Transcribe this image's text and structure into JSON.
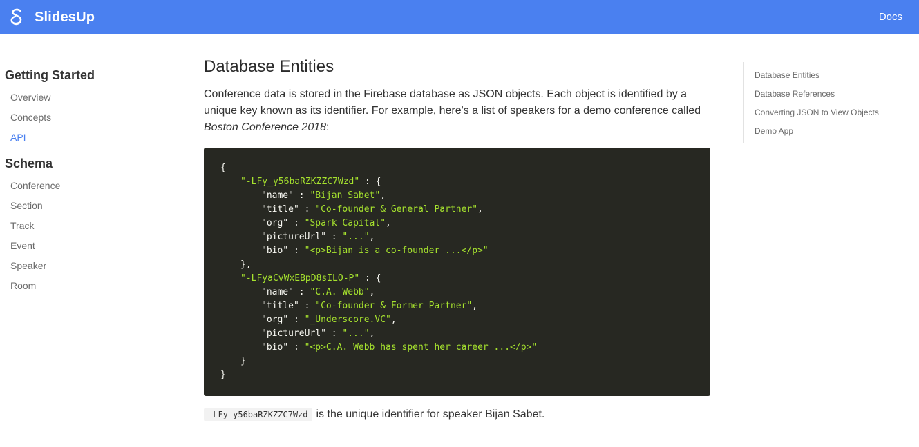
{
  "header": {
    "brand": "SlidesUp",
    "docs_label": "Docs",
    "logo_icon": "slidesup-logo-icon",
    "background": "#4a80f0"
  },
  "sidebar": {
    "sections": [
      {
        "heading": "Getting Started",
        "items": [
          {
            "label": "Overview",
            "active": false
          },
          {
            "label": "Concepts",
            "active": false
          },
          {
            "label": "API",
            "active": true
          }
        ]
      },
      {
        "heading": "Schema",
        "items": [
          {
            "label": "Conference",
            "active": false
          },
          {
            "label": "Section",
            "active": false
          },
          {
            "label": "Track",
            "active": false
          },
          {
            "label": "Event",
            "active": false
          },
          {
            "label": "Speaker",
            "active": false
          },
          {
            "label": "Room",
            "active": false
          }
        ]
      }
    ]
  },
  "main": {
    "title": "Database Entities",
    "intro_text": "Conference data is stored in the Firebase database as JSON objects. Each object is identified by a unique key known as its identifier. For example, here's a list of speakers for a demo conference called ",
    "intro_em": "Boston Conference 2018",
    "intro_end": ":",
    "code": {
      "open": "{",
      "close": "}",
      "entries": [
        {
          "key": "\"-LFy_y56baRZKZZC7Wzd\"",
          "fields": [
            {
              "name": "\"name\"",
              "value": "\"Bijan Sabet\"",
              "comma": ","
            },
            {
              "name": "\"title\"",
              "value": "\"Co-founder & General Partner\"",
              "comma": ","
            },
            {
              "name": "\"org\"",
              "value": "\"Spark Capital\"",
              "comma": ","
            },
            {
              "name": "\"pictureUrl\"",
              "value": "\"...\"",
              "comma": ","
            },
            {
              "name": "\"bio\"",
              "value": "\"<p>Bijan is a co-founder ...</p>\"",
              "comma": ""
            }
          ],
          "end": "},"
        },
        {
          "key": "\"-LFyaCvWxEBpD8sILO-P\"",
          "fields": [
            {
              "name": "\"name\"",
              "value": "\"C.A. Webb\"",
              "comma": ","
            },
            {
              "name": "\"title\"",
              "value": "\"Co-founder & Former Partner\"",
              "comma": ","
            },
            {
              "name": "\"org\"",
              "value": "\"_Underscore.VC\"",
              "comma": ","
            },
            {
              "name": "\"pictureUrl\"",
              "value": "\"...\"",
              "comma": ","
            },
            {
              "name": "\"bio\"",
              "value": "\"<p>C.A. Webb has spent her career ...</p>\"",
              "comma": ""
            }
          ],
          "end": "}"
        }
      ]
    },
    "note_code": "-LFy_y56baRZKZZC7Wzd",
    "note_text": "is the unique identifier for speaker Bijan Sabet."
  },
  "toc": {
    "items": [
      "Database Entities",
      "Database References",
      "Converting JSON to View Objects",
      "Demo App"
    ]
  }
}
